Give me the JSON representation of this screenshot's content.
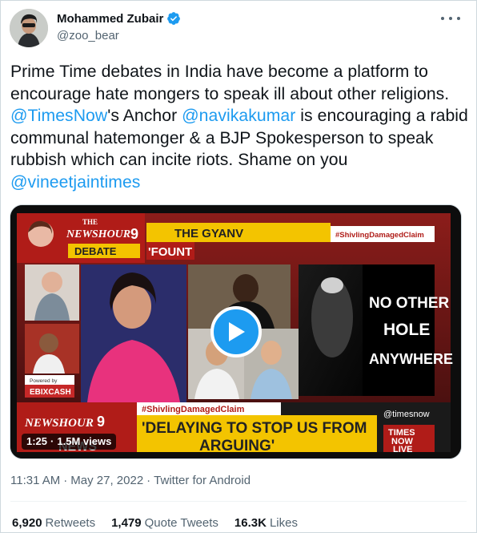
{
  "author": {
    "display_name": "Mohammed Zubair",
    "handle": "@zoo_bear"
  },
  "tweet": {
    "parts": [
      {
        "text": "Prime Time debates in India have become a platform to encourage hate mongers to speak ill about other religions. ",
        "mention": false
      },
      {
        "text": "@TimesNow",
        "mention": true
      },
      {
        "text": "'s Anchor ",
        "mention": false
      },
      {
        "text": "@navikakumar",
        "mention": true
      },
      {
        "text": " is encouraging a rabid communal hatemonger & a BJP Spokesperson to speak rubbish which can incite riots. Shame on you ",
        "mention": false
      },
      {
        "text": "@vineetjaintimes",
        "mention": true
      }
    ]
  },
  "video": {
    "duration": "1:25",
    "views": "1.5M views",
    "screen_text": {
      "show_name_top": "THE",
      "show_name": "NEWSHOUR",
      "show_number": "9",
      "debate": "DEBATE",
      "segment": "THE GYANV",
      "segment_line2": "'FOUNT",
      "hashtag_top": "#ShivlingDamagedClaim",
      "hashtag_bottom": "#ShivlingDamagedClaim",
      "right_panel": [
        "NO OTHER",
        "HOLE",
        "ANYWHERE"
      ],
      "headline_line1": "'DELAYING TO STOP US FROM",
      "headline_line2": "ARGUING'",
      "sponsor_label": "Powered by",
      "sponsor": "EBIXCASH",
      "channel_handle": "@timesnow",
      "channel_name": [
        "TIMES",
        "NOW",
        "LIVE"
      ],
      "lower_left": "NEWS"
    }
  },
  "meta": {
    "time": "11:31 AM",
    "dot1": "·",
    "date": "May 27, 2022",
    "dot2": "·",
    "source": "Twitter for Android"
  },
  "stats": [
    {
      "value": "6,920",
      "label": "Retweets"
    },
    {
      "value": "1,479",
      "label": "Quote Tweets"
    },
    {
      "value": "16.3K",
      "label": "Likes"
    }
  ],
  "colors": {
    "accent": "#1d9bf0",
    "text": "#0f1419",
    "muted": "#536471",
    "border": "#cfd9de"
  }
}
